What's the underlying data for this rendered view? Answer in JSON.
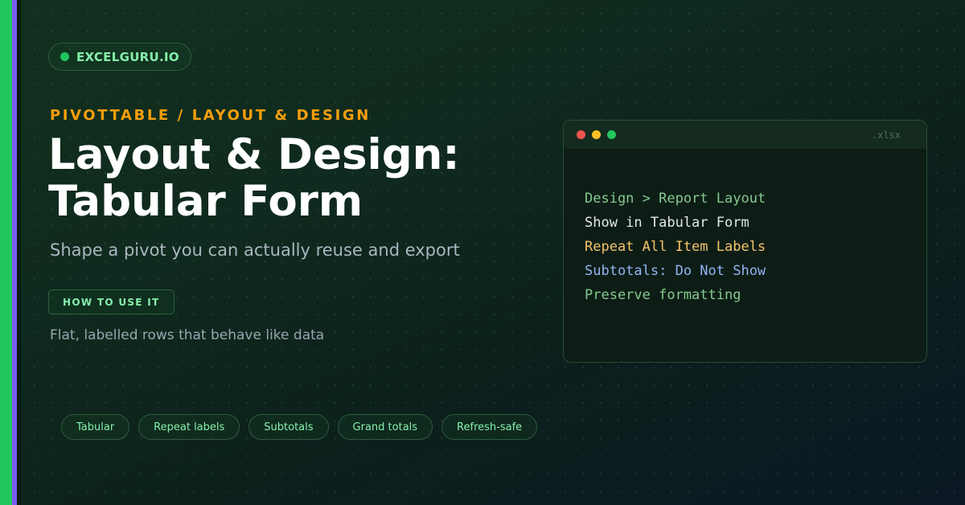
{
  "brand": {
    "name": "EXCELGURU.IO"
  },
  "hero": {
    "eyebrow": "PIVOTTABLE / LAYOUT & DESIGN",
    "title_line1": "Layout & Design:",
    "title_line2": "Tabular Form",
    "subtitle": "Shape a pivot you can actually reuse and export",
    "howto_label": "HOW TO USE IT",
    "description": "Flat, labelled rows that behave like data"
  },
  "window": {
    "extension": ".xlsx",
    "lines": [
      {
        "text": "Design > Report Layout",
        "color": "#86c98f"
      },
      {
        "text": "Show in Tabular Form",
        "color": "#e5e7eb"
      },
      {
        "text": "Repeat All Item Labels",
        "color": "#f6c46b"
      },
      {
        "text": "Subtotals: Do Not Show",
        "color": "#93b4f5"
      },
      {
        "text": "Preserve formatting",
        "color": "#86c98f"
      }
    ]
  },
  "chips": [
    "Tabular",
    "Repeat labels",
    "Subtotals",
    "Grand totals",
    "Refresh-safe"
  ],
  "colors": {
    "accent_green": "#22c55e",
    "accent_purple": "#7c5cf0",
    "eyebrow_orange": "#f59e0b",
    "chip_text": "#86efac"
  }
}
